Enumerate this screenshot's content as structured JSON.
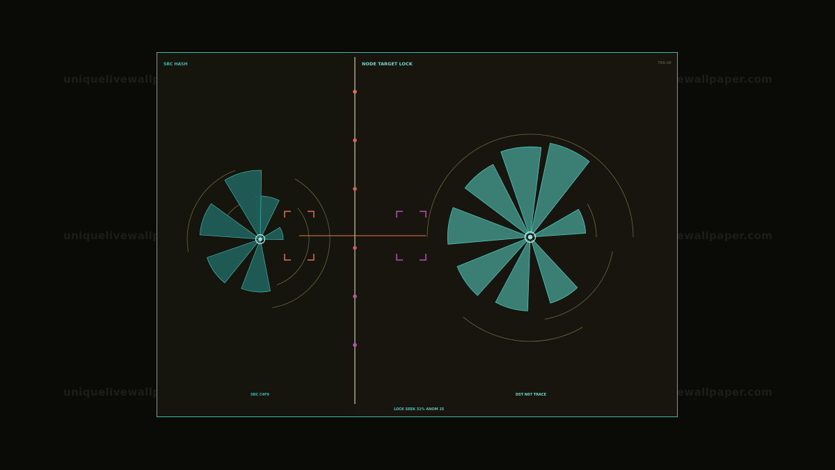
{
  "watermark": "uniquelivewallpaper.com",
  "header": {
    "left_label": "SRC HASH",
    "center_title": "NODE TARGET LOCK",
    "right_code": "TRK-48"
  },
  "footer": {
    "left_caption": "SRC  C4F9",
    "right_caption": "DST  N07  TRACE",
    "status": "LOCK SEEK  31%  ANOM 25"
  },
  "colors": {
    "frame": "#3fb7ad",
    "petal_dark": "#1f5d59",
    "petal_light": "#3f8a7f",
    "petal_stroke": "#4cc9bd",
    "arc": "#6b6a3e",
    "lock_orange": "#e0714f",
    "lock_magenta": "#b752b4",
    "axis": "#9a9a8c"
  },
  "lock_progress": 0.31,
  "source_node": {
    "petals": [
      {
        "angle": -15,
        "length": 0.33
      },
      {
        "angle": -80,
        "length": 0.62
      },
      {
        "angle": -105,
        "length": 0.99
      },
      {
        "angle": -160,
        "length": 0.87
      },
      {
        "angle": -215,
        "length": 0.81
      },
      {
        "angle": -265,
        "length": 0.76
      }
    ]
  },
  "target_node": {
    "petals": [
      {
        "angle": -17,
        "length": 0.58
      },
      {
        "angle": -65,
        "length": 1.0
      },
      {
        "angle": -96,
        "length": 0.94
      },
      {
        "angle": -130,
        "length": 0.85
      },
      {
        "angle": -172,
        "length": 0.86
      },
      {
        "angle": -215,
        "length": 0.82
      },
      {
        "angle": -255,
        "length": 0.77
      },
      {
        "angle": -300,
        "length": 0.72
      }
    ]
  },
  "axis_markers": [
    {
      "pos": 0.1,
      "color": "#e0714f"
    },
    {
      "pos": 0.24,
      "color": "#d7695a"
    },
    {
      "pos": 0.38,
      "color": "#cc6262"
    },
    {
      "pos": 0.55,
      "color": "#c45c75"
    },
    {
      "pos": 0.69,
      "color": "#bd5690"
    },
    {
      "pos": 0.83,
      "color": "#b752b4"
    }
  ]
}
